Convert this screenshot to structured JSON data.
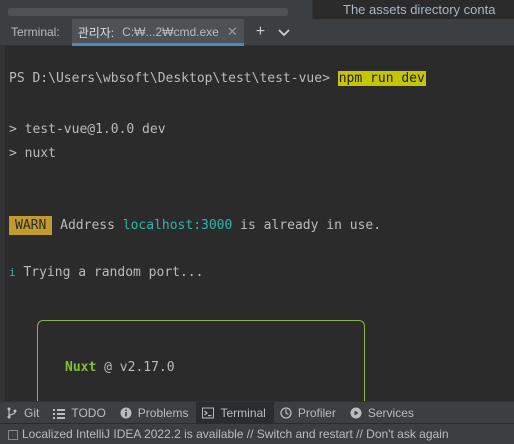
{
  "editor": {
    "peek_text": "The assets directory conta"
  },
  "terminal": {
    "title": "Terminal:",
    "tab": {
      "name": "관리자:",
      "path": "C:₩...2₩cmd.exe",
      "close": "✕"
    },
    "add_label": "+"
  },
  "output": {
    "prompt": "PS D:\\Users\\wbsoft\\Desktop\\test\\test-vue> ",
    "command": "npm run dev",
    "line1": "> test-vue@1.0.0 dev",
    "line2": "> nuxt",
    "warn_badge": "WARN",
    "warn_pre": " Address ",
    "warn_host": "localhost:3000",
    "warn_post": " is already in use.",
    "info_mark": "i",
    "info_text": " Trying a random port...",
    "nuxt_name": "Nuxt",
    "nuxt_rest": " @ v2.17.0"
  },
  "tool_tabs": [
    {
      "label": "Git",
      "icon": "git-branch-icon"
    },
    {
      "label": "TODO",
      "icon": "list-icon"
    },
    {
      "label": "Problems",
      "icon": "info-icon"
    },
    {
      "label": "Terminal",
      "icon": "terminal-icon",
      "active": true
    },
    {
      "label": "Profiler",
      "icon": "profiler-icon"
    },
    {
      "label": "Services",
      "icon": "play-icon"
    }
  ],
  "status": {
    "text": "Localized IntelliJ IDEA 2022.2 is available // Switch and restart // Don't ask again"
  },
  "colors": {
    "accent": "#4a88c7",
    "warn": "#c39a2e",
    "teal": "#2fb5a5",
    "nuxt_green": "#7fc237",
    "command_highlight": "#c5c500"
  }
}
